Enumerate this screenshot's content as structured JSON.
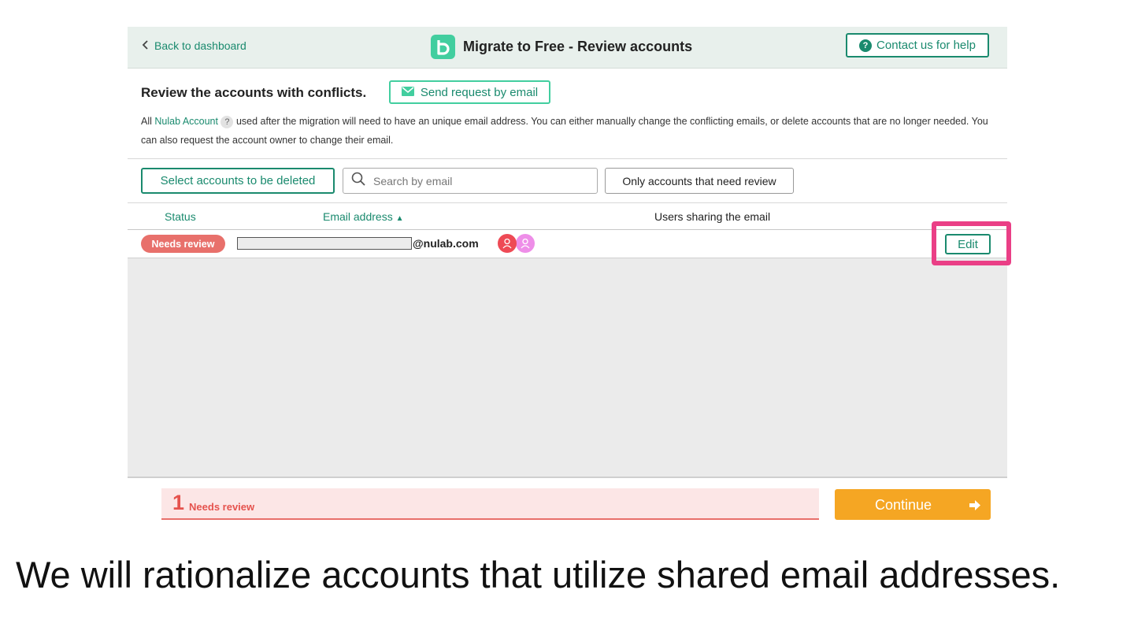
{
  "header": {
    "back_label": "Back to dashboard",
    "title": "Migrate to Free - Review accounts",
    "help_label": "Contact us for help",
    "logo_letter": "b"
  },
  "review": {
    "heading": "Review the accounts with conflicts.",
    "send_email_label": "Send request by email",
    "desc_prefix": "All ",
    "desc_link": "Nulab Account",
    "desc_qmark": "?",
    "desc_rest": " used after the migration will need to have an unique email address. You can either manually change the conflicting emails, or delete accounts that are no longer needed. You can also request the account owner to change their email."
  },
  "toolbar": {
    "select_label": "Select accounts to be deleted",
    "search_placeholder": "Search by email",
    "filter_label": "Only accounts that need review"
  },
  "table": {
    "columns": {
      "status": "Status",
      "email": "Email address",
      "email_sort_icon": "▲",
      "users": "Users sharing the email"
    },
    "rows": [
      {
        "status": "Needs review",
        "email_domain": "@nulab.com",
        "edit_label": "Edit",
        "avatars": [
          "user-icon",
          "user-icon"
        ]
      }
    ]
  },
  "footer": {
    "count": "1",
    "count_label": "Needs review",
    "continue_label": "Continue"
  },
  "caption": "We will rationalize accounts that utilize shared email addresses.",
  "colors": {
    "brand_green": "#1a8a6e",
    "logo_green": "#42ce9f",
    "needs_review": "#e8706b",
    "continue": "#f5a623",
    "highlight": "#ea3f86"
  }
}
